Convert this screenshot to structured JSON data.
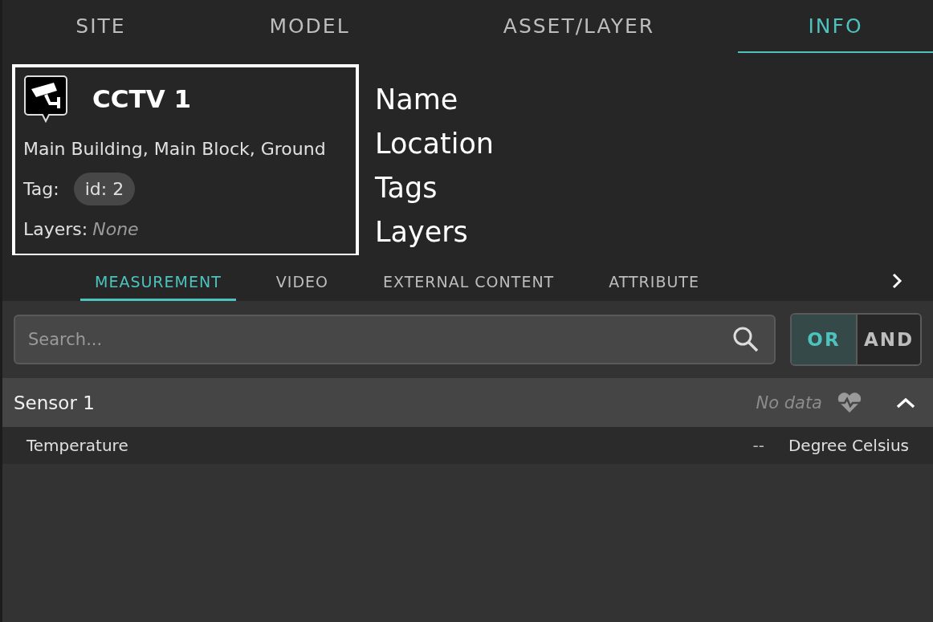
{
  "tabs": [
    {
      "label": "SITE",
      "selected": false
    },
    {
      "label": "MODEL",
      "selected": false
    },
    {
      "label": "ASSET/LAYER",
      "selected": false
    },
    {
      "label": "INFO",
      "selected": true
    }
  ],
  "asset": {
    "name": "CCTV 1",
    "location": "Main Building, Main Block, Ground",
    "tag_label": "Tag:",
    "tags": [
      "id: 2"
    ],
    "layers_label": "Layers:",
    "layers_value": "None"
  },
  "annotations": [
    "Name",
    "Location",
    "Tags",
    "Layers"
  ],
  "subtabs": [
    {
      "label": "MEASUREMENT",
      "selected": true
    },
    {
      "label": "VIDEO",
      "selected": false
    },
    {
      "label": "EXTERNAL CONTENT",
      "selected": false
    },
    {
      "label": "ATTRIBUTE",
      "selected": false
    }
  ],
  "search": {
    "placeholder": "Search..."
  },
  "logic": [
    {
      "label": "OR",
      "selected": true
    },
    {
      "label": "AND",
      "selected": false
    }
  ],
  "sensors": [
    {
      "name": "Sensor 1",
      "status": "No data",
      "expanded": true,
      "measurements": [
        {
          "name": "Temperature",
          "value": "--",
          "unit": "Degree Celsius"
        }
      ]
    }
  ]
}
